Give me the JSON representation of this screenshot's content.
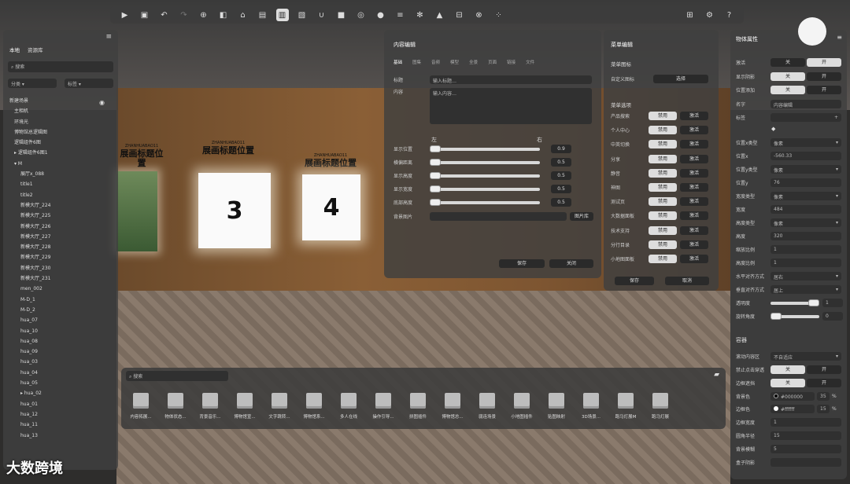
{
  "toolbar": {
    "icons": [
      "play-icon",
      "save-icon",
      "undo-icon",
      "redo-icon",
      "target-icon",
      "cube-icon",
      "building-icon",
      "grid-icon",
      "book-icon",
      "image-icon",
      "magnet-icon",
      "camera-icon",
      "sphere-icon",
      "media-icon",
      "list-icon",
      "settings-icon",
      "graduation-icon",
      "box-icon",
      "close-circle-icon",
      "grid-dots-icon"
    ],
    "right_icons": [
      "apps-icon",
      "gear-icon",
      "help-icon"
    ]
  },
  "scene": {
    "frames": [
      "3",
      "4"
    ],
    "sign_top": "ZHANHUABAO11",
    "sign_main": "展画标题位置"
  },
  "left": {
    "tabs": [
      "本地",
      "资源库"
    ],
    "search_placeholder": "搜索",
    "filter1": "分类",
    "filter2": "标签",
    "items": [
      "新建场景",
      "主相机",
      "环境光",
      "博物馆总逻辑图",
      "逻辑组件6图",
      "▸ 逻辑组件6图1",
      "▾ M",
      "展厅x_088",
      "title1",
      "title2",
      "新模大厅_224",
      "新模大厅_225",
      "新模大厅_226",
      "新模大厅_227",
      "新模大厅_228",
      "新模大厅_229",
      "新模大厅_230",
      "新模大厅_231",
      "men_002",
      "M-D_1",
      "M-D_2",
      "hua_07",
      "hua_10",
      "hua_08",
      "hua_09",
      "hua_03",
      "hua_04",
      "hua_05",
      "▸ hua_02",
      "hua_01",
      "hua_12",
      "hua_11",
      "hua_13"
    ]
  },
  "content": {
    "title": "内容编辑",
    "tabs": [
      "基础",
      "图集",
      "音频",
      "模型",
      "全景",
      "页面",
      "链接",
      "文件"
    ],
    "title_label": "标题",
    "title_placeholder": "输入标题…",
    "content_label": "内容",
    "content_placeholder": "输入内容…",
    "left": "左",
    "right": "右",
    "sliders": [
      {
        "label": "显示位置",
        "value": "0.9",
        "fill": 0.9
      },
      {
        "label": "横偏距离",
        "value": "0.5",
        "fill": 0.5
      },
      {
        "label": "显示高度",
        "value": "0.5",
        "fill": 0.5
      },
      {
        "label": "显示宽度",
        "value": "0.5",
        "fill": 0.5
      },
      {
        "label": "底部高度",
        "value": "0.5",
        "fill": 0.5
      }
    ],
    "bg_label": "背景图片",
    "bg_button": "图片库",
    "save": "保存",
    "close": "关闭"
  },
  "menu": {
    "title": "菜单编辑",
    "section1": "菜单图标",
    "custom_icon": "自定义图标",
    "select": "选择",
    "section2": "菜单选项",
    "items": [
      "产品搜索",
      "个人中心",
      "中英切换",
      "分享",
      "静音",
      "神图",
      "测试页",
      "大数据面板",
      "技术支持",
      "分行目录",
      "小地图面板"
    ],
    "disable": "禁用",
    "enable": "激活",
    "save": "保存",
    "cancel": "取消"
  },
  "props": {
    "title": "物体属性",
    "rows": [
      {
        "label": "激活",
        "type": "toggle",
        "off": "关",
        "on": "开",
        "active": "on"
      },
      {
        "label": "显示阴影",
        "type": "toggle",
        "off": "关",
        "on": "开",
        "active": "off"
      },
      {
        "label": "位置添加",
        "type": "toggle",
        "off": "关",
        "on": "开",
        "active": "off"
      },
      {
        "label": "名字",
        "type": "input",
        "value": "内容编辑"
      },
      {
        "label": "标签",
        "type": "plus",
        "value": "+"
      }
    ],
    "tag_icon": "tag-icon",
    "fields": [
      {
        "label": "位置x类型",
        "value": "像素",
        "dd": true
      },
      {
        "label": "位置x",
        "value": "-560.33"
      },
      {
        "label": "位置y类型",
        "value": "像素",
        "dd": true
      },
      {
        "label": "位置y",
        "value": "76"
      },
      {
        "label": "宽度类型",
        "value": "像素",
        "dd": true
      },
      {
        "label": "宽度",
        "value": "484"
      },
      {
        "label": "高度类型",
        "value": "像素",
        "dd": true
      },
      {
        "label": "高度",
        "value": "320"
      },
      {
        "label": "缩放比例",
        "value": "1"
      },
      {
        "label": "高度比例",
        "value": "1"
      },
      {
        "label": "水平对齐方式",
        "value": "居右",
        "dd": true
      },
      {
        "label": "垂直对齐方式",
        "value": "居上",
        "dd": true
      }
    ],
    "opacity_label": "透明度",
    "opacity_value": "1",
    "opacity": 1,
    "radius_label": "旋转角度",
    "radius_value": "0",
    "radius": 0,
    "container_title": "容器",
    "c_rows": [
      {
        "label": "滚动内容区",
        "value": "不自适应",
        "dd": true
      },
      {
        "label": "禁止点击穿透",
        "type": "toggle",
        "off": "关",
        "on": "开",
        "active": "off"
      },
      {
        "label": "边框遮挡",
        "type": "toggle",
        "off": "关",
        "on": "开",
        "active": "off"
      }
    ],
    "bg_label": "背景色",
    "bg_color": "#000000",
    "bg_pct": "35",
    "border_label": "边框色",
    "border_color": "#ffffff",
    "border_pct": "15",
    "pct": "%",
    "extra": [
      {
        "label": "边框宽度",
        "value": "1"
      },
      {
        "label": "圆角半径",
        "value": "15"
      },
      {
        "label": "背景模糊",
        "value": "5"
      },
      {
        "label": "盒子阴影",
        "value": ""
      }
    ]
  },
  "assets": {
    "search_placeholder": "搜索",
    "items": [
      "内容拓展...",
      "物体状态...",
      "背景音乐...",
      "博物馆宣...",
      "文字跳转...",
      "博物馆系...",
      "多人在线",
      "操作引导...",
      "拼图插件",
      "博物馆总...",
      "弱连场景",
      "小地图插件",
      "贴图映射",
      "3D场景...",
      "跑马灯展M",
      "跑马灯展"
    ]
  },
  "watermark": "大数跨境",
  "user_icon": "avatar"
}
